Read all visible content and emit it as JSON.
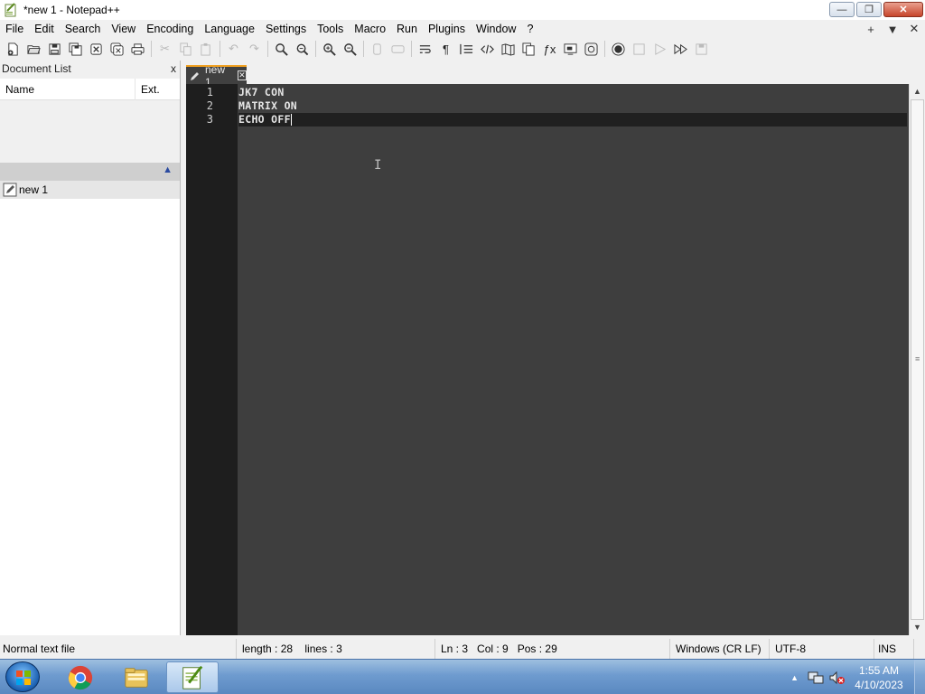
{
  "window": {
    "title": "*new 1 - Notepad++",
    "controls": {
      "minimize": "—",
      "maximize": "❐",
      "close": "✕"
    }
  },
  "menu": {
    "items": [
      "File",
      "Edit",
      "Search",
      "View",
      "Encoding",
      "Language",
      "Settings",
      "Tools",
      "Macro",
      "Run",
      "Plugins",
      "Window",
      "?"
    ],
    "right": {
      "add": "+",
      "dropdown": "▼",
      "close": "✕"
    }
  },
  "toolbar": {
    "buttons": [
      {
        "name": "new-file-icon",
        "enabled": true
      },
      {
        "name": "open-file-icon",
        "enabled": true
      },
      {
        "name": "save-icon",
        "enabled": true
      },
      {
        "name": "save-all-icon",
        "enabled": true
      },
      {
        "name": "close-file-icon",
        "enabled": true
      },
      {
        "name": "close-all-icon",
        "enabled": true
      },
      {
        "name": "print-icon",
        "enabled": true
      },
      {
        "name": "cut-icon",
        "enabled": false
      },
      {
        "name": "copy-icon",
        "enabled": false
      },
      {
        "name": "paste-icon",
        "enabled": false
      },
      {
        "name": "undo-icon",
        "enabled": false
      },
      {
        "name": "redo-icon",
        "enabled": false
      },
      {
        "name": "find-icon",
        "enabled": true
      },
      {
        "name": "replace-icon",
        "enabled": true
      },
      {
        "name": "zoom-in-icon",
        "enabled": true
      },
      {
        "name": "zoom-out-icon",
        "enabled": true
      },
      {
        "name": "sync-vertical-icon",
        "enabled": false
      },
      {
        "name": "sync-horizontal-icon",
        "enabled": false
      },
      {
        "name": "word-wrap-icon",
        "enabled": true
      },
      {
        "name": "show-all-chars-icon",
        "enabled": true
      },
      {
        "name": "indent-guide-icon",
        "enabled": true
      },
      {
        "name": "xml-tag-icon",
        "enabled": true
      },
      {
        "name": "document-map-icon",
        "enabled": true
      },
      {
        "name": "document-list-icon",
        "enabled": true
      },
      {
        "name": "function-list-icon",
        "enabled": true
      },
      {
        "name": "folder-workspace-icon",
        "enabled": true
      },
      {
        "name": "monitoring-icon",
        "enabled": true
      },
      {
        "name": "record-macro-icon",
        "enabled": true
      },
      {
        "name": "stop-recording-icon",
        "enabled": false
      },
      {
        "name": "playback-macro-icon",
        "enabled": false
      },
      {
        "name": "run-macro-multiple-icon",
        "enabled": true
      },
      {
        "name": "save-macro-icon",
        "enabled": false
      }
    ]
  },
  "doclist": {
    "header": "Document List",
    "close": "x",
    "columns": {
      "name": "Name",
      "ext": "Ext."
    },
    "files": [
      {
        "name": "new 1",
        "ext": ""
      }
    ]
  },
  "tabs": [
    {
      "label": "new 1",
      "modified": true
    }
  ],
  "editor": {
    "line_numbers": [
      "1",
      "2",
      "3"
    ],
    "lines": [
      "JK7 CON",
      "MATRIX ON",
      "ECHO OFF"
    ],
    "current_line": 3
  },
  "status": {
    "file_type": "Normal text file",
    "length": "length : 28",
    "lines": "lines : 3",
    "ln": "Ln : 3",
    "col": "Col : 9",
    "pos": "Pos : 29",
    "eol": "Windows (CR LF)",
    "encoding": "UTF-8",
    "mode": "INS"
  },
  "taskbar": {
    "apps": [
      "chrome-icon",
      "file-explorer-icon",
      "notepadpp-icon"
    ],
    "clock_time": "1:55 AM",
    "clock_date": "4/10/2023"
  },
  "colors": {
    "editor_bg": "#3e3e3e",
    "gutter_bg": "#1e1e1e",
    "tab_accent": "#f0a020"
  }
}
